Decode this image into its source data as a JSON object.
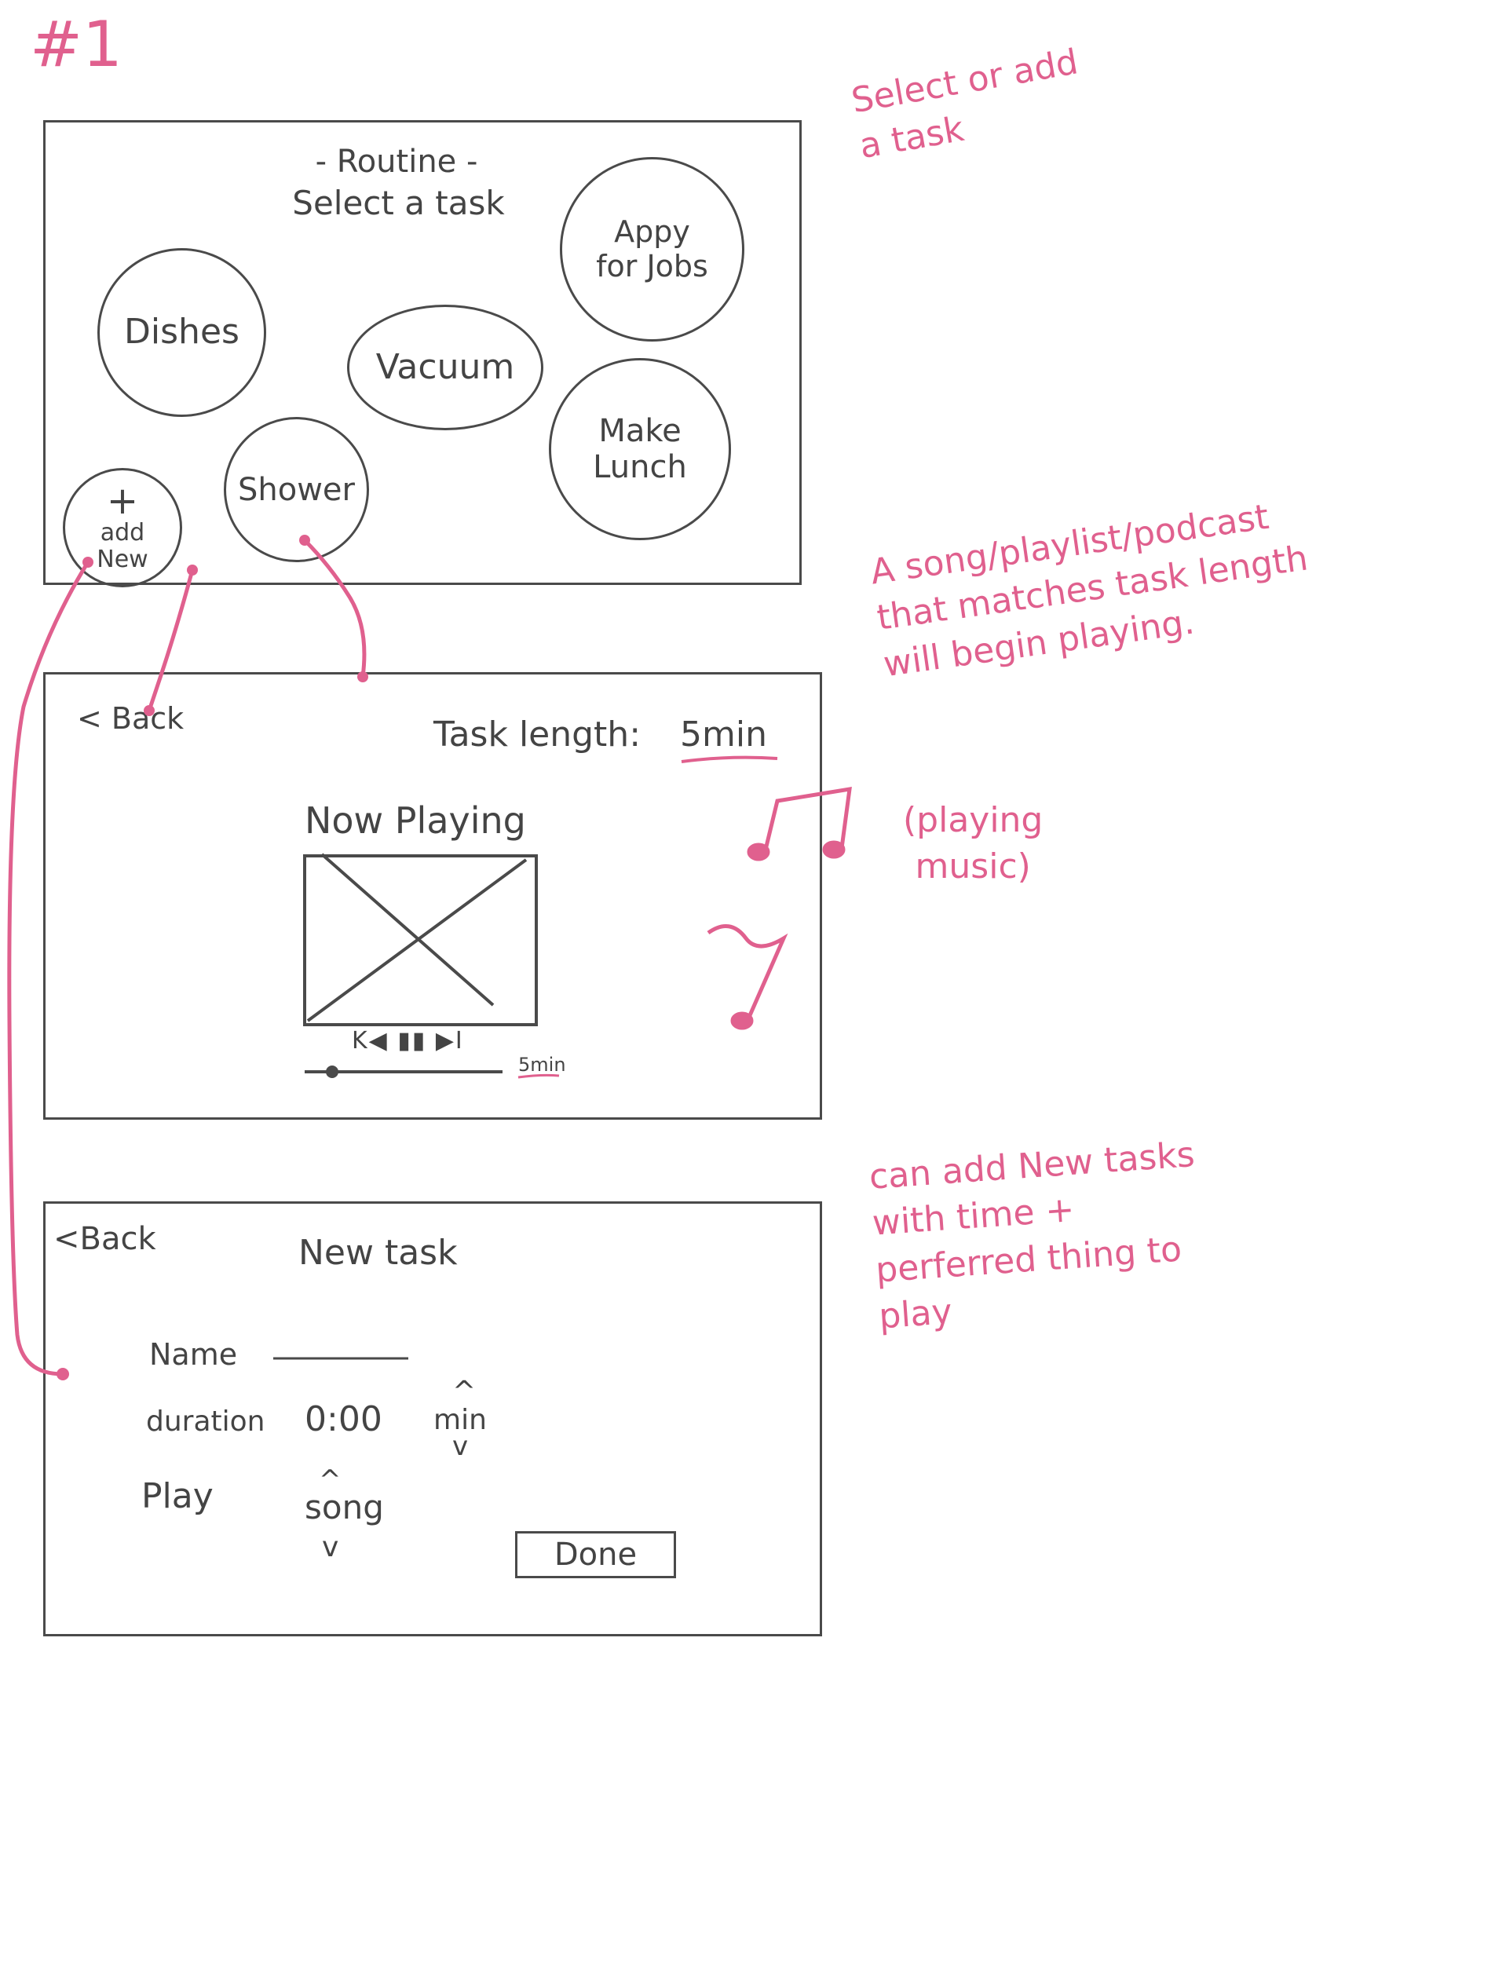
{
  "page_number": "#1",
  "screen1": {
    "title": "- Routine -",
    "subtitle": "Select a task",
    "tasks": [
      "Dishes",
      "Vacuum",
      "Appy for Jobs",
      "Make Lunch",
      "Shower"
    ],
    "add_plus": "+",
    "add_label": "add New"
  },
  "screen2": {
    "back": "< Back",
    "task_length_label": "Task length:",
    "task_length_value": "5min",
    "now_playing": "Now Playing",
    "controls": "K◀ ▮▮ ▶I",
    "duration": "5min"
  },
  "screen3": {
    "back": "<Back",
    "title": "New task",
    "name_label": "Name",
    "duration_label": "duration",
    "duration_value": "0:00",
    "duration_unit": "min",
    "play_label": "Play",
    "play_value": "song",
    "done": "Done",
    "up_arrow": "^",
    "down_arrow": "v"
  },
  "annotations": {
    "a1": "Select or add\na task",
    "a2": "A song/playlist/podcast\nthat matches task length\nwill begin playing.",
    "a3": "(playing\nmusic)",
    "a4": "can add New tasks\nwith time +\nperferred thing to\nplay"
  },
  "colors": {
    "ink": "#4a4a4a",
    "accent": "#e0608e"
  }
}
